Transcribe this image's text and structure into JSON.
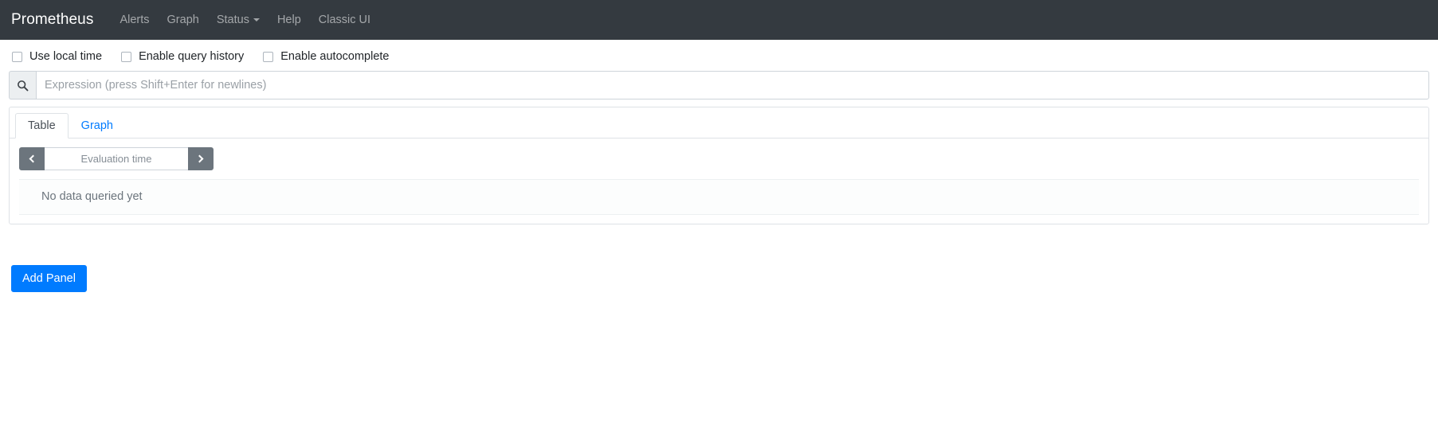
{
  "navbar": {
    "brand": "Prometheus",
    "links": [
      {
        "label": "Alerts",
        "icon": "",
        "has_caret": false
      },
      {
        "label": "Graph",
        "icon": "",
        "has_caret": false
      },
      {
        "label": "Status",
        "icon": "chevron-down-icon",
        "has_caret": true
      },
      {
        "label": "Help",
        "icon": "",
        "has_caret": false
      },
      {
        "label": "Classic UI",
        "icon": "",
        "has_caret": false
      }
    ],
    "background_color": "#343a40"
  },
  "options": {
    "checkboxes": [
      {
        "label": "Use local time",
        "checked": false
      },
      {
        "label": "Enable query history",
        "checked": false
      },
      {
        "label": "Enable autocomplete",
        "checked": false
      }
    ]
  },
  "expression": {
    "icon": "search-icon",
    "value": "",
    "placeholder": "Expression (press Shift+Enter for newlines)"
  },
  "panel": {
    "tabs": [
      {
        "label": "Table",
        "active": true
      },
      {
        "label": "Graph",
        "active": false
      }
    ],
    "evaluation_time": {
      "prev_icon": "chevron-left-icon",
      "next_icon": "chevron-right-icon",
      "display": "Evaluation time",
      "value": ""
    },
    "empty_state": "No data queried yet"
  },
  "footer": {
    "add_panel_label": "Add Panel",
    "accent_color": "#007bff"
  }
}
